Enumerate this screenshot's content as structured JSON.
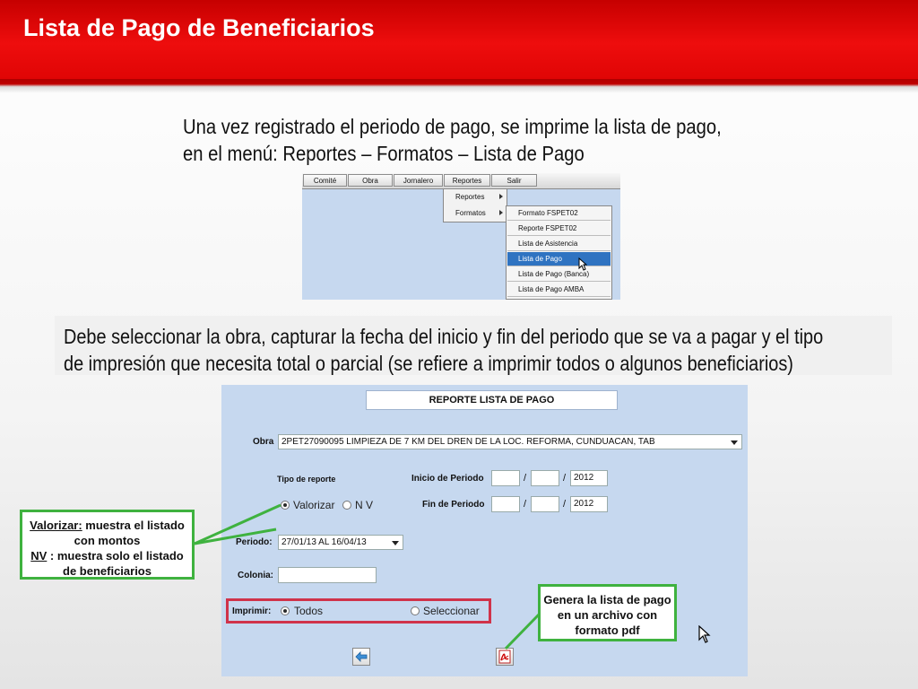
{
  "slide_title": "Lista de Pago de Beneficiarios",
  "intro": {
    "line1": "Una vez  registrado el periodo de pago, se imprime la lista de pago,",
    "line2": "en el menú:   Reportes – Formatos – Lista de Pago"
  },
  "menu": {
    "bar": [
      "Comité",
      "Obra",
      "Jornalero",
      "Reportes",
      "Salir"
    ],
    "submenu": [
      "Reportes",
      "Formatos"
    ],
    "formatos": [
      "Formato FSPET02",
      "Reporte FSPET02",
      "Lista de Asistencia",
      "Lista de Pago",
      "Lista de Pago (Banca)",
      "Lista de Pago AMBA"
    ],
    "selected": "Lista de Pago"
  },
  "instruction": {
    "line1": "Debe seleccionar la obra, capturar la fecha del inicio y fin del periodo que se va a pagar y el tipo",
    "line2": "de impresión que necesita total o parcial (se refiere a imprimir todos o algunos beneficiarios)"
  },
  "form": {
    "title": "REPORTE LISTA DE PAGO",
    "obra_label": "Obra",
    "obra_value": "2PET27090095 LIMPIEZA DE 7 KM DEL DREN DE LA LOC. REFORMA, CUNDUACAN, TAB",
    "tipo_label": "Tipo de reporte",
    "tipo_options": [
      "Valorizar",
      "N V"
    ],
    "tipo_selected": "Valorizar",
    "inicio_label": "Inicio de Periodo",
    "fin_label": "Fin de Periodo",
    "inicio_day": "",
    "inicio_month": "",
    "inicio_year": "2012",
    "fin_day": "",
    "fin_month": "",
    "fin_year": "2012",
    "slash": "/",
    "periodo_label": "Periodo:",
    "periodo_value": "27/01/13 AL 16/04/13",
    "colonia_label": "Colonia:",
    "colonia_value": "",
    "imprimir_label": "Imprimir:",
    "imprimir_options": [
      "Todos",
      "Seleccionar"
    ],
    "imprimir_selected": "Todos"
  },
  "callouts": {
    "valorizar_term": "Valorizar:",
    "valorizar_desc": " muestra el listado con montos",
    "nv_term": "NV",
    "nv_desc": " : muestra solo el listado de beneficiarios",
    "pdf": "Genera la lista de pago en un archivo con formato pdf"
  },
  "colors": {
    "title_red": "#e00505",
    "form_bg": "#c6d8ef",
    "menu_selected": "#2f73c1",
    "callout_border": "#3fb23f",
    "highlight_box": "#d0334a"
  },
  "icons": [
    "back-arrow-icon",
    "pdf-icon",
    "mouse-cursor-icon",
    "submenu-arrow-icon",
    "dropdown-arrow-icon"
  ]
}
